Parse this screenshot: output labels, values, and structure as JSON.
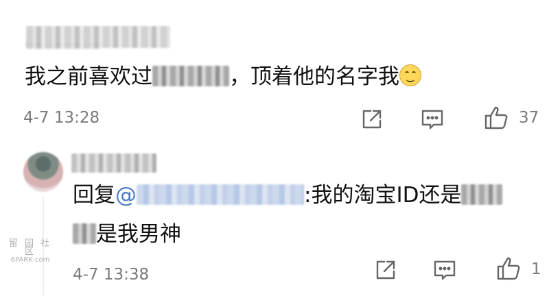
{
  "comment": {
    "username_hidden": true,
    "text_before": "我之前喜欢过",
    "text_after": "，顶着他的名字我",
    "emoji": "tongue-out-emoji",
    "time": "4-7 13:28",
    "like_count": "37"
  },
  "reply": {
    "username_hidden": true,
    "prefix": "回复",
    "mention_at": "@",
    "text_mid": ":我的淘宝ID还是",
    "text_end": "是我男神",
    "time": "4-7 13:38",
    "like_count": "1"
  },
  "watermark": {
    "line1": "留 园 社 区",
    "line2": "6PARK·com"
  },
  "icons": {
    "share": "share-icon",
    "comment": "comment-icon",
    "like": "thumbs-up-icon"
  }
}
